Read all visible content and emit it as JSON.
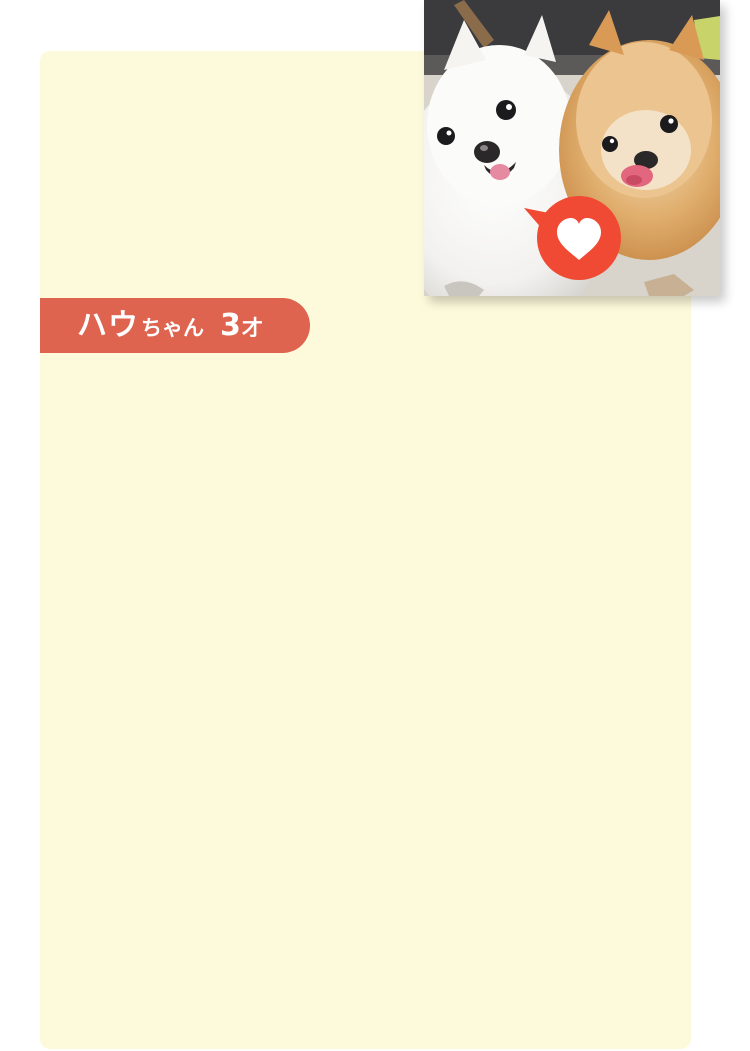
{
  "profile": {
    "name_main": "ハウ",
    "name_suffix": "ちゃん",
    "age_number": "3",
    "age_unit": "才"
  },
  "icons": {
    "like": "heart-icon"
  },
  "colors": {
    "card_background": "#fdfadc",
    "name_tag": "#de6450",
    "heart_bubble": "#f04a35",
    "heart": "#ffffff"
  }
}
